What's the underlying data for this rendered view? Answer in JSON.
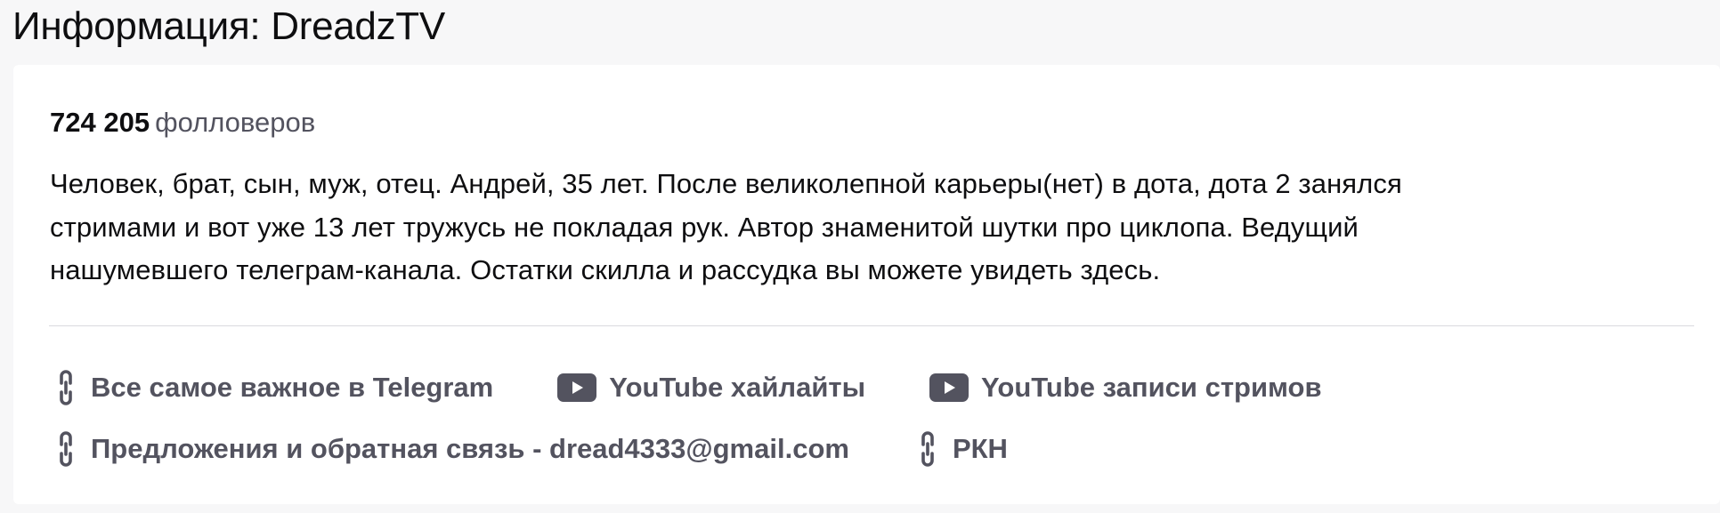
{
  "header": {
    "title_prefix": "Информация: ",
    "channel_name": "DreadzTV"
  },
  "about": {
    "followers_count": "724 205",
    "followers_label": "фолловеров",
    "description_lines": [
      "Человек, брат, сын, муж, отец. Андрей, 35 лет. После великолепной карьеры(нет) в дота, дота 2 занялся",
      "стримами и вот уже 13 лет тружусь не покладая рук. Автор знаменитой шутки про циклопа. Ведущий",
      "нашумевшего телеграм-канала. Остатки скилла и рассудка вы можете увидеть здесь."
    ]
  },
  "links": [
    {
      "label": "Все самое важное в Telegram",
      "icon": "link-icon"
    },
    {
      "label": "YouTube хайлайты",
      "icon": "youtube-icon"
    },
    {
      "label": "YouTube записи стримов",
      "icon": "youtube-icon"
    },
    {
      "label": "Предложения и обратная связь - dread4333@gmail.com",
      "icon": "link-icon"
    },
    {
      "label": "РКН",
      "icon": "link-icon"
    }
  ],
  "colors": {
    "background": "#f7f7f8",
    "card": "#ffffff",
    "text_primary": "#0e0e10",
    "text_secondary": "#53535f",
    "divider": "#dadade"
  }
}
